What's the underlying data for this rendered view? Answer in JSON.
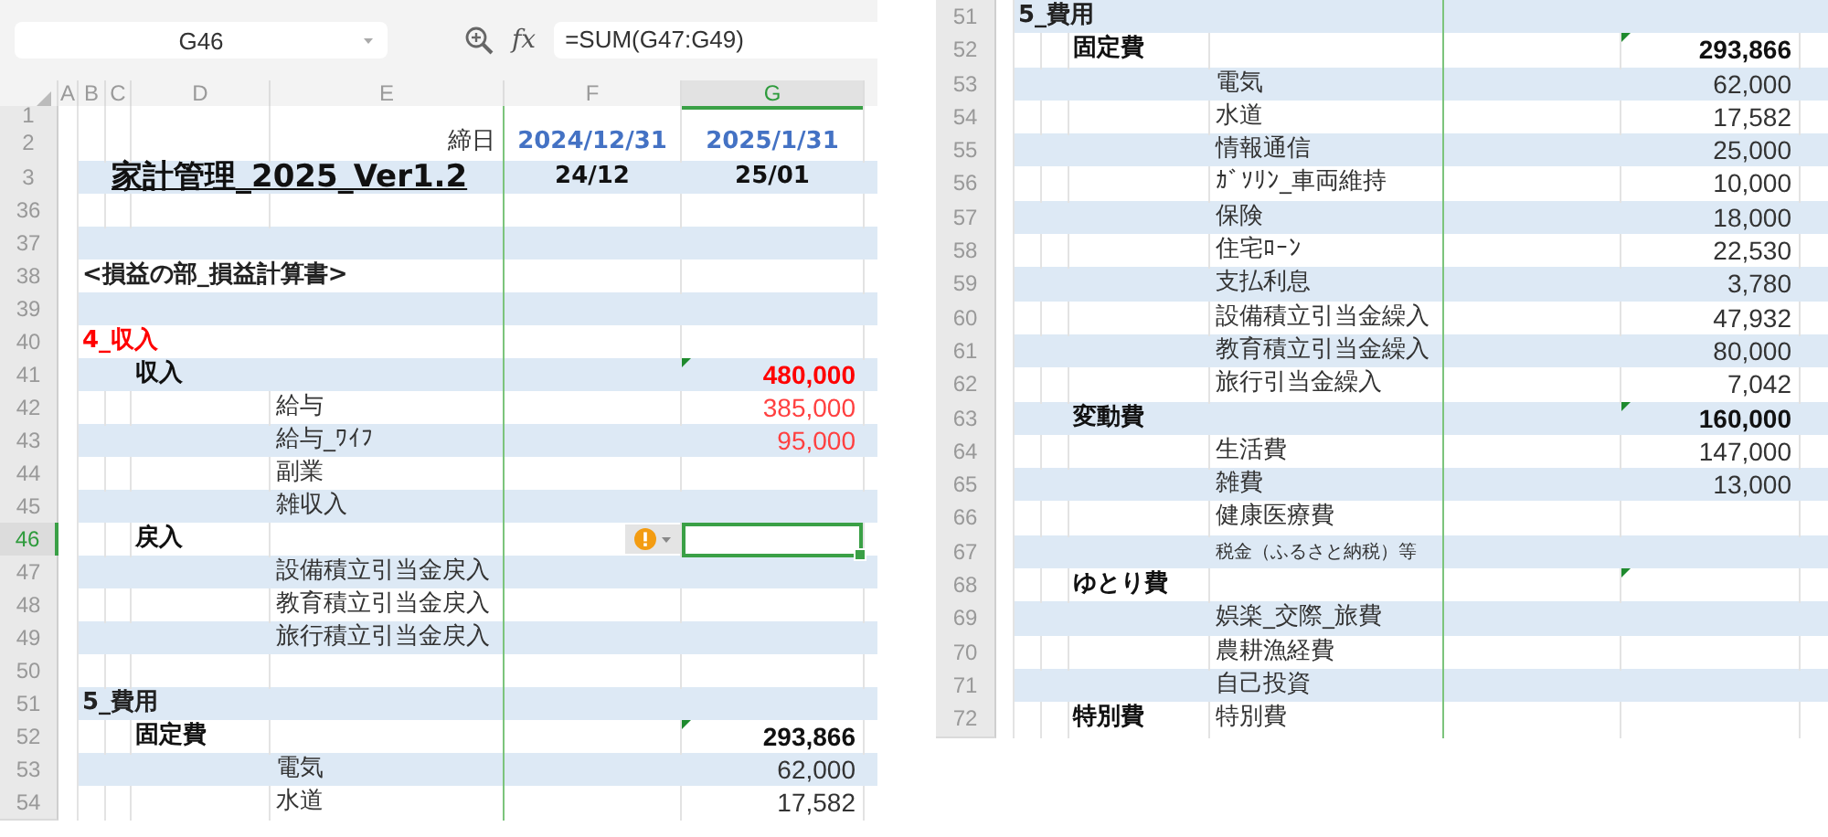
{
  "formula_bar": {
    "name_box": "G46",
    "function_label": "fx",
    "formula": "=SUM(G47:G49)"
  },
  "left_sheet": {
    "columns": [
      {
        "label": "A",
        "selected": false
      },
      {
        "label": "B",
        "selected": false
      },
      {
        "label": "C",
        "selected": false
      },
      {
        "label": "D",
        "selected": false
      },
      {
        "label": "E",
        "selected": false
      },
      {
        "label": "F",
        "selected": false
      },
      {
        "label": "G",
        "selected": true
      }
    ],
    "rows": [
      {
        "number": "1",
        "kind": "spacer",
        "banded": false,
        "selected": false,
        "flagged": false
      },
      {
        "number": "2",
        "kind": "dates",
        "banded": false,
        "selected": false,
        "flagged": false,
        "label": "締日",
        "f": "2024/12/31",
        "g": "2025/1/31"
      },
      {
        "number": "3",
        "kind": "title",
        "banded": true,
        "selected": false,
        "flagged": false,
        "title": "家計管理_2025_Ver1.2",
        "f": "24/12",
        "g": "25/01"
      },
      {
        "number": "36",
        "kind": "line",
        "banded": false,
        "selected": false,
        "flagged": false
      },
      {
        "number": "37",
        "kind": "line",
        "banded": true,
        "selected": false,
        "flagged": false
      },
      {
        "number": "38",
        "kind": "line",
        "banded": false,
        "selected": false,
        "flagged": false,
        "section": "<損益の部_損益計算書>"
      },
      {
        "number": "39",
        "kind": "line",
        "banded": true,
        "selected": false,
        "flagged": false
      },
      {
        "number": "40",
        "kind": "line",
        "banded": false,
        "selected": false,
        "flagged": false,
        "section": {
          "text": "4_収入",
          "color": "#ff0000"
        }
      },
      {
        "number": "41",
        "kind": "line",
        "banded": true,
        "selected": false,
        "flagged": true,
        "group": "収入",
        "value": {
          "text": "480,000",
          "color": "#ff0000"
        }
      },
      {
        "number": "42",
        "kind": "line",
        "banded": false,
        "selected": false,
        "flagged": false,
        "item": "給与",
        "value": {
          "text": "385,000",
          "color": "#ff4040"
        }
      },
      {
        "number": "43",
        "kind": "line",
        "banded": true,
        "selected": false,
        "flagged": false,
        "item": "給与_ﾜｲﾌ",
        "value": {
          "text": "95,000",
          "color": "#ff4040"
        }
      },
      {
        "number": "44",
        "kind": "line",
        "banded": false,
        "selected": false,
        "flagged": false,
        "item": "副業"
      },
      {
        "number": "45",
        "kind": "line",
        "banded": true,
        "selected": false,
        "flagged": false,
        "item": "雑収入"
      },
      {
        "number": "46",
        "kind": "line",
        "banded": false,
        "selected": true,
        "flagged": false,
        "group": "戻入"
      },
      {
        "number": "47",
        "kind": "line",
        "banded": true,
        "selected": false,
        "flagged": false,
        "item": "設備積立引当金戻入"
      },
      {
        "number": "48",
        "kind": "line",
        "banded": false,
        "selected": false,
        "flagged": false,
        "item": "教育積立引当金戻入"
      },
      {
        "number": "49",
        "kind": "line",
        "banded": true,
        "selected": false,
        "flagged": false,
        "item": "旅行積立引当金戻入"
      },
      {
        "number": "50",
        "kind": "line",
        "banded": false,
        "selected": false,
        "flagged": false
      },
      {
        "number": "51",
        "kind": "line",
        "banded": true,
        "selected": false,
        "flagged": false,
        "section": "5_費用"
      },
      {
        "number": "52",
        "kind": "line",
        "banded": false,
        "selected": false,
        "flagged": true,
        "group": "固定費",
        "value": "293,866"
      },
      {
        "number": "53",
        "kind": "line",
        "banded": true,
        "selected": false,
        "flagged": false,
        "item": "電気",
        "value": "62,000"
      },
      {
        "number": "54",
        "kind": "line",
        "banded": false,
        "selected": false,
        "flagged": false,
        "item": "水道",
        "value": "17,582"
      }
    ]
  },
  "right_sheet": {
    "rows": [
      {
        "number": "51",
        "kind": "line",
        "banded": true,
        "selected": false,
        "flagged": false,
        "section": "5_費用"
      },
      {
        "number": "52",
        "kind": "line",
        "banded": false,
        "selected": false,
        "flagged": true,
        "group": "固定費",
        "value": "293,866"
      },
      {
        "number": "53",
        "kind": "line",
        "banded": true,
        "selected": false,
        "flagged": false,
        "item": "電気",
        "value": "62,000"
      },
      {
        "number": "54",
        "kind": "line",
        "banded": false,
        "selected": false,
        "flagged": false,
        "item": "水道",
        "value": "17,582"
      },
      {
        "number": "55",
        "kind": "line",
        "banded": true,
        "selected": false,
        "flagged": false,
        "item": "情報通信",
        "value": "25,000"
      },
      {
        "number": "56",
        "kind": "line",
        "banded": false,
        "selected": false,
        "flagged": false,
        "item": "ｶﾞｿﾘﾝ_車両維持",
        "value": "10,000"
      },
      {
        "number": "57",
        "kind": "line",
        "banded": true,
        "selected": false,
        "flagged": false,
        "item": "保険",
        "value": "18,000"
      },
      {
        "number": "58",
        "kind": "line",
        "banded": false,
        "selected": false,
        "flagged": false,
        "item": "住宅ﾛｰﾝ",
        "value": "22,530"
      },
      {
        "number": "59",
        "kind": "line",
        "banded": true,
        "selected": false,
        "flagged": false,
        "item": "支払利息",
        "value": "3,780"
      },
      {
        "number": "60",
        "kind": "line",
        "banded": false,
        "selected": false,
        "flagged": false,
        "item": "設備積立引当金繰入",
        "value": "47,932"
      },
      {
        "number": "61",
        "kind": "line",
        "banded": true,
        "selected": false,
        "flagged": false,
        "item": "教育積立引当金繰入",
        "value": "80,000"
      },
      {
        "number": "62",
        "kind": "line",
        "banded": false,
        "selected": false,
        "flagged": false,
        "item": "旅行引当金繰入",
        "value": "7,042"
      },
      {
        "number": "63",
        "kind": "line",
        "banded": true,
        "selected": false,
        "flagged": true,
        "group": "変動費",
        "value": "160,000"
      },
      {
        "number": "64",
        "kind": "line",
        "banded": false,
        "selected": false,
        "flagged": false,
        "item": "生活費",
        "value": "147,000"
      },
      {
        "number": "65",
        "kind": "line",
        "banded": true,
        "selected": false,
        "flagged": false,
        "item": "雑費",
        "value": "13,000"
      },
      {
        "number": "66",
        "kind": "line",
        "banded": false,
        "selected": false,
        "flagged": false,
        "item": "健康医療費"
      },
      {
        "number": "67",
        "kind": "line",
        "banded": true,
        "selected": false,
        "flagged": false,
        "item": "税金（ふるさと納税）等",
        "item_small": true
      },
      {
        "number": "68",
        "kind": "line",
        "banded": false,
        "selected": false,
        "flagged": true,
        "group": "ゆとり費"
      },
      {
        "number": "69",
        "kind": "line",
        "banded": true,
        "selected": false,
        "flagged": false,
        "item": "娯楽_交際_旅費"
      },
      {
        "number": "70",
        "kind": "line",
        "banded": false,
        "selected": false,
        "flagged": false,
        "item": "農耕漁経費"
      },
      {
        "number": "71",
        "kind": "line",
        "banded": true,
        "selected": false,
        "flagged": false,
        "item": "自己投資"
      },
      {
        "number": "72",
        "kind": "line",
        "banded": false,
        "selected": false,
        "flagged": false,
        "group": "特別費",
        "item": "特別費"
      }
    ]
  }
}
